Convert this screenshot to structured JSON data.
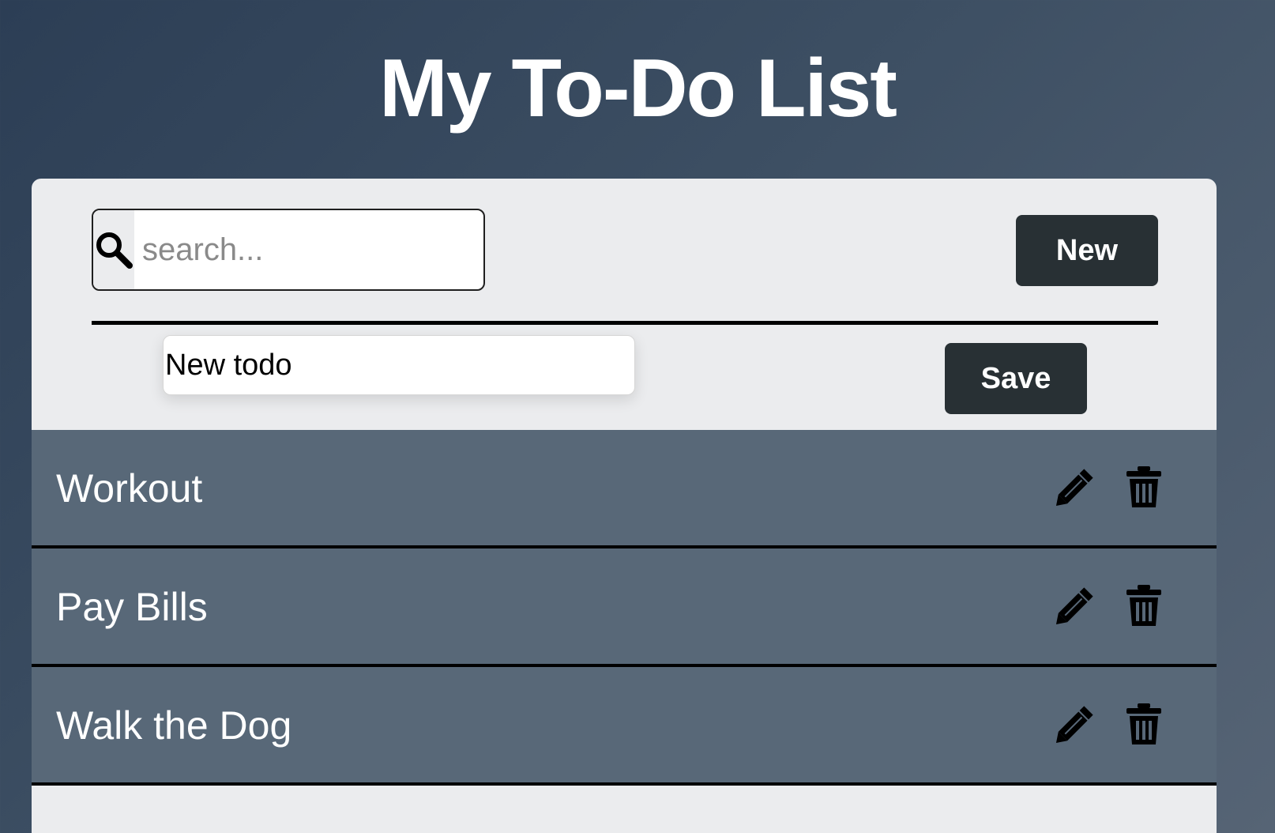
{
  "header": {
    "title": "My To-Do List"
  },
  "toolbar": {
    "search": {
      "placeholder": "search...",
      "value": "",
      "icon": "search-icon"
    },
    "new_label": "New"
  },
  "editor": {
    "value": "New todo",
    "save_label": "Save"
  },
  "todos": [
    {
      "label": "Workout",
      "edit_icon": "pencil-icon",
      "delete_icon": "trash-icon"
    },
    {
      "label": "Pay Bills",
      "edit_icon": "pencil-icon",
      "delete_icon": "trash-icon"
    },
    {
      "label": "Walk the Dog",
      "edit_icon": "pencil-icon",
      "delete_icon": "trash-icon"
    }
  ],
  "colors": {
    "button": "#283034",
    "row": "#586878",
    "card": "#ebecee"
  }
}
